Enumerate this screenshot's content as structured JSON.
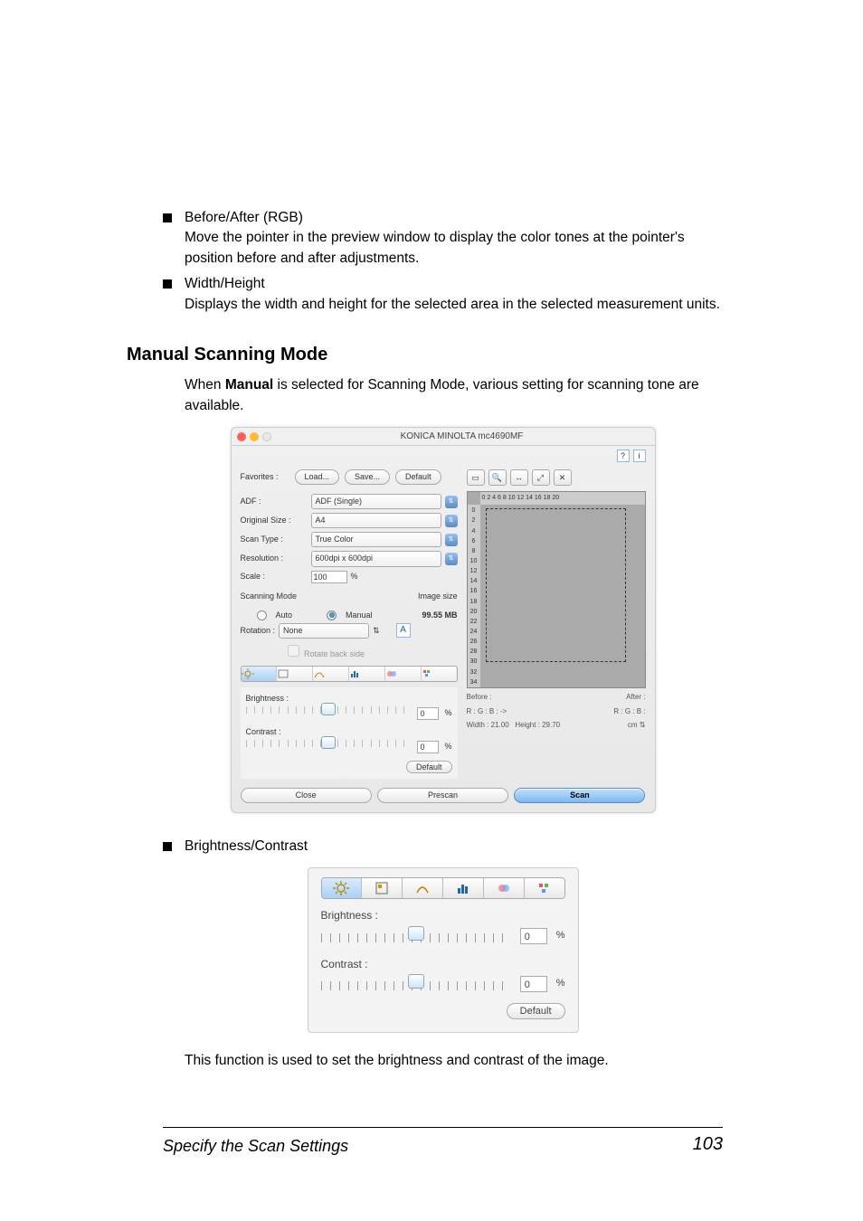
{
  "bullets": {
    "before_after_title": "Before/After (RGB)",
    "before_after_desc": "Move the pointer in the preview window to display the color tones at the pointer's position before and after adjustments.",
    "wh_title": "Width/Height",
    "wh_desc": "Displays the width and height for the selected area in the selected measurement units.",
    "bc_title": "Brightness/Contrast"
  },
  "section": {
    "heading": "Manual Scanning Mode",
    "intro_pre": "When ",
    "intro_bold": "Manual",
    "intro_post": " is selected for Scanning Mode, various setting for scanning tone are available."
  },
  "dialog": {
    "title": "KONICA MINOLTA mc4690MF",
    "favorites_label": "Favorites :",
    "load_btn": "Load...",
    "save_btn": "Save...",
    "default_btn": "Default",
    "adf_label": "ADF :",
    "adf_value": "ADF (Single)",
    "size_label": "Original Size :",
    "size_value": "A4",
    "scantype_label": "Scan Type :",
    "scantype_value": "True Color",
    "res_label": "Resolution :",
    "res_value": "600dpi x 600dpi",
    "scale_label": "Scale :",
    "scale_value": "100",
    "scale_unit": "%",
    "scanmode_label": "Scanning Mode",
    "imgsize_label": "Image size",
    "auto_label": "Auto",
    "manual_label": "Manual",
    "imgsize_value": "99.55 MB",
    "rotation_label": "Rotation :",
    "rotation_value": "None",
    "rotate_chk": "Rotate back side",
    "brightness_label": "Brightness :",
    "b_val": "0",
    "b_unit": "%",
    "contrast_label": "Contrast :",
    "c_val": "0",
    "c_unit": "%",
    "default_inner": "Default",
    "close_btn": "Close",
    "prescan_btn": "Prescan",
    "scan_btn": "Scan",
    "ruler_x": "0  2  4  6  8  10 12 14 16 18 20",
    "before_label": "Before :",
    "after_label": "After :",
    "rgb_before": "R :        G :        B :       ->",
    "rgb_after": "R :        G :        B :",
    "width_info": "Width : 21.00",
    "height_info": "Height : 29.70",
    "unit": "cm",
    "help_q": "?",
    "help_i": "i"
  },
  "chart_data": {
    "type": "table",
    "title": "Scanner preview ruler",
    "ruler_y": [
      0,
      2,
      4,
      6,
      8,
      10,
      12,
      14,
      16,
      18,
      20,
      22,
      24,
      26,
      28,
      30,
      32,
      34
    ],
    "ruler_x": [
      0,
      2,
      4,
      6,
      8,
      10,
      12,
      14,
      16,
      18,
      20
    ]
  },
  "shot2": {
    "brightness_label": "Brightness :",
    "b_val": "0",
    "b_unit": "%",
    "contrast_label": "Contrast :",
    "c_val": "0",
    "c_unit": "%",
    "default_btn": "Default"
  },
  "para": "This function is used to set the brightness and contrast of the image.",
  "footer": {
    "title": "Specify the Scan Settings",
    "page": "103"
  }
}
